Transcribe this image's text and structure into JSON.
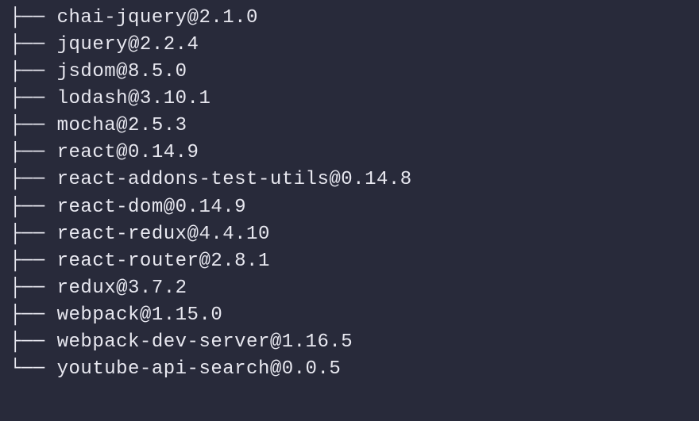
{
  "packages": [
    {
      "name": "chai-jquery",
      "version": "2.1.0",
      "last": false
    },
    {
      "name": "jquery",
      "version": "2.2.4",
      "last": false
    },
    {
      "name": "jsdom",
      "version": "8.5.0",
      "last": false
    },
    {
      "name": "lodash",
      "version": "3.10.1",
      "last": false
    },
    {
      "name": "mocha",
      "version": "2.5.3",
      "last": false
    },
    {
      "name": "react",
      "version": "0.14.9",
      "last": false
    },
    {
      "name": "react-addons-test-utils",
      "version": "0.14.8",
      "last": false
    },
    {
      "name": "react-dom",
      "version": "0.14.9",
      "last": false
    },
    {
      "name": "react-redux",
      "version": "4.4.10",
      "last": false
    },
    {
      "name": "react-router",
      "version": "2.8.1",
      "last": false
    },
    {
      "name": "redux",
      "version": "3.7.2",
      "last": false
    },
    {
      "name": "webpack",
      "version": "1.15.0",
      "last": false
    },
    {
      "name": "webpack-dev-server",
      "version": "1.16.5",
      "last": false
    },
    {
      "name": "youtube-api-search",
      "version": "0.0.5",
      "last": true
    }
  ],
  "tree": {
    "branch": "├── ",
    "lastBranch": "└── "
  }
}
